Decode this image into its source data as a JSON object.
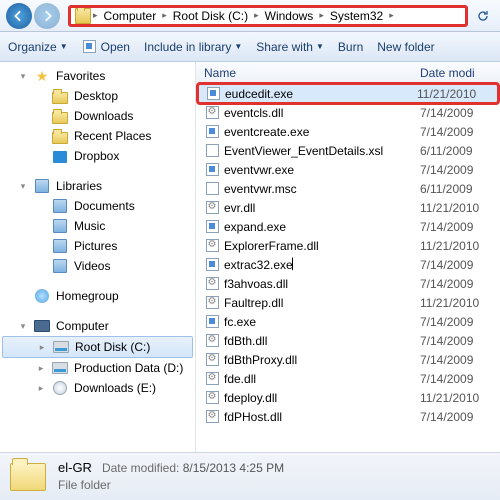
{
  "breadcrumbs": [
    "Computer",
    "Root Disk (C:)",
    "Windows",
    "System32"
  ],
  "cmd": {
    "organize": "Organize",
    "open": "Open",
    "include": "Include in library",
    "share": "Share with",
    "burn": "Burn",
    "newfolder": "New folder"
  },
  "tree": {
    "favorites": "Favorites",
    "fav": [
      "Desktop",
      "Downloads",
      "Recent Places",
      "Dropbox"
    ],
    "libraries": "Libraries",
    "libs": [
      "Documents",
      "Music",
      "Pictures",
      "Videos"
    ],
    "homegroup": "Homegroup",
    "computer": "Computer",
    "drives": [
      "Root Disk (C:)",
      "Production Data (D:)",
      "Downloads (E:)"
    ]
  },
  "cols": {
    "name": "Name",
    "date": "Date modi"
  },
  "files": [
    {
      "n": "eudcedit.exe",
      "d": "11/21/2010",
      "t": "exe",
      "sel": true,
      "hl": true
    },
    {
      "n": "eventcls.dll",
      "d": "7/14/2009",
      "t": "dll"
    },
    {
      "n": "eventcreate.exe",
      "d": "7/14/2009",
      "t": "exe"
    },
    {
      "n": "EventViewer_EventDetails.xsl",
      "d": "6/11/2009",
      "t": "xsl"
    },
    {
      "n": "eventvwr.exe",
      "d": "7/14/2009",
      "t": "exe"
    },
    {
      "n": "eventvwr.msc",
      "d": "6/11/2009",
      "t": "msc"
    },
    {
      "n": "evr.dll",
      "d": "11/21/2010",
      "t": "dll"
    },
    {
      "n": "expand.exe",
      "d": "7/14/2009",
      "t": "exe"
    },
    {
      "n": "ExplorerFrame.dll",
      "d": "11/21/2010",
      "t": "dll"
    },
    {
      "n": "extrac32.exe",
      "d": "7/14/2009",
      "t": "exe",
      "cur": true
    },
    {
      "n": "f3ahvoas.dll",
      "d": "7/14/2009",
      "t": "dll"
    },
    {
      "n": "Faultrep.dll",
      "d": "11/21/2010",
      "t": "dll"
    },
    {
      "n": "fc.exe",
      "d": "7/14/2009",
      "t": "exe"
    },
    {
      "n": "fdBth.dll",
      "d": "7/14/2009",
      "t": "dll"
    },
    {
      "n": "fdBthProxy.dll",
      "d": "7/14/2009",
      "t": "dll"
    },
    {
      "n": "fde.dll",
      "d": "7/14/2009",
      "t": "dll"
    },
    {
      "n": "fdeploy.dll",
      "d": "11/21/2010",
      "t": "dll"
    },
    {
      "n": "fdPHost.dll",
      "d": "7/14/2009",
      "t": "dll"
    }
  ],
  "status": {
    "name": "el-GR",
    "type": "File folder",
    "dm_label": "Date modified:",
    "dm": "8/15/2013 4:25 PM"
  }
}
